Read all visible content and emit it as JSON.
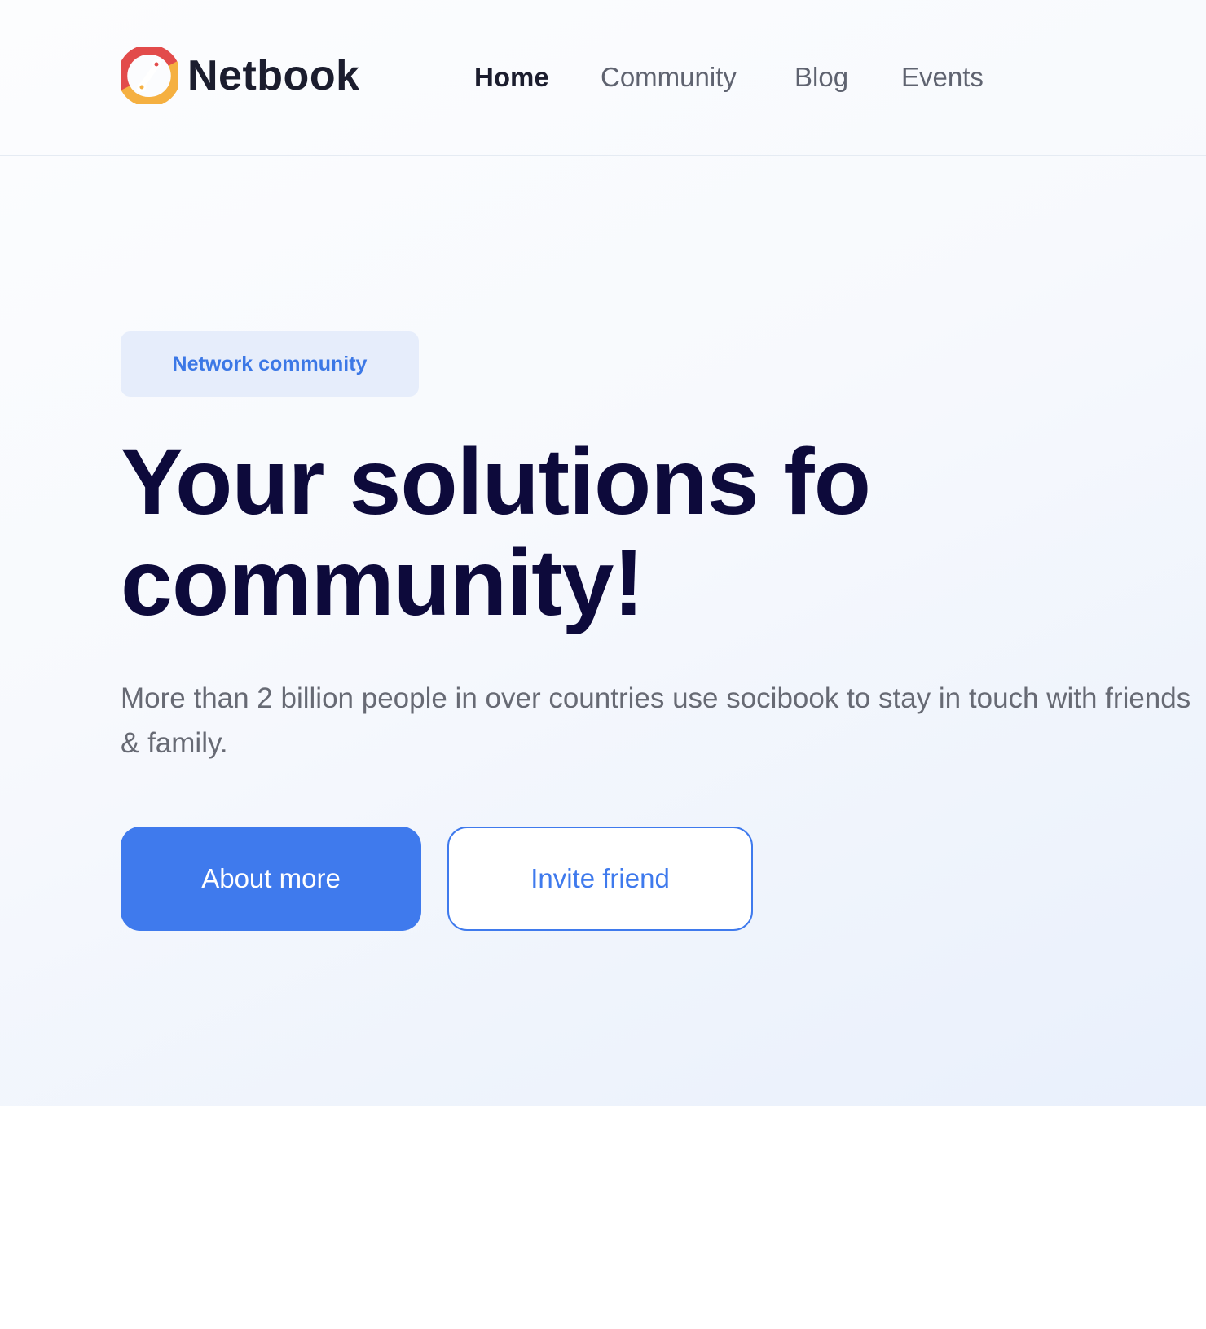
{
  "header": {
    "brand": "Netbook",
    "logo_icon": "netbook-logo-icon",
    "nav": [
      {
        "label": "Home",
        "active": true
      },
      {
        "label": "Community",
        "active": false
      },
      {
        "label": "Blog",
        "active": false
      },
      {
        "label": "Events",
        "active": false
      }
    ]
  },
  "hero": {
    "badge": "Network community",
    "headline_line1": "Your solutions fo",
    "headline_line2": "community!",
    "description": "More than 2 billion people in over countries use socibook to stay in touch with friends & family.",
    "primary_button": "About more",
    "secondary_button": "Invite friend"
  },
  "colors": {
    "accent": "#3f7aed",
    "headline": "#0d0a3b",
    "badge_bg": "#e6edfb",
    "logo_red": "#e24b4b",
    "logo_orange": "#f5b041"
  }
}
